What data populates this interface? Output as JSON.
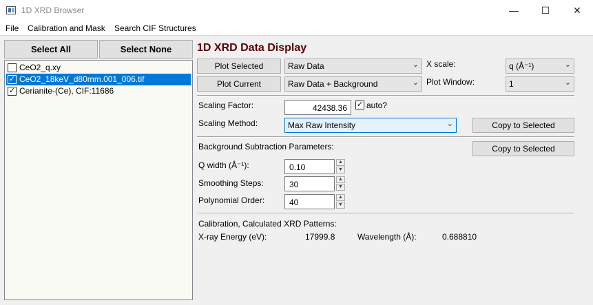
{
  "window": {
    "title": "1D XRD Browser",
    "minimize": "—",
    "maximize": "☐",
    "close": "✕"
  },
  "menu": {
    "items": [
      "File",
      "Calibration and Mask",
      "Search CIF Structures"
    ]
  },
  "left": {
    "select_all": "Select All",
    "select_none": "Select None",
    "files": [
      {
        "label": "CeO2_q.xy",
        "checked": false,
        "selected": false
      },
      {
        "label": "CeO2_18keV_d80mm.001_006.tif",
        "checked": true,
        "selected": true
      },
      {
        "label": "Cerianite-(Ce), CIF:11686",
        "checked": true,
        "selected": false
      }
    ]
  },
  "main": {
    "heading": "1D XRD Data Display",
    "plot_selected": "Plot Selected",
    "plot_current": "Plot Current",
    "data_mode_1": "Raw Data",
    "data_mode_2": "Raw Data + Background",
    "xscale_label": "X scale:",
    "xscale_value": "q (Å⁻¹)",
    "plotwin_label": "Plot Window:",
    "plotwin_value": "1",
    "scaling_factor_label": "Scaling Factor:",
    "scaling_factor_value": "42438.36",
    "auto_label": "auto?",
    "auto_checked": true,
    "scaling_method_label": "Scaling Method:",
    "scaling_method_value": "Max Raw Intensity",
    "copy_selected": "Copy to Selected",
    "bg_section": "Background Subtraction Parameters:",
    "qwidth_label": "Q width (Å⁻¹):",
    "qwidth_value": "0.10",
    "smooth_label": "Smoothing Steps:",
    "smooth_value": "30",
    "poly_label": "Polynomial Order:",
    "poly_value": "40",
    "calib_section": "Calibration, Calculated XRD Patterns:",
    "energy_label": "X-ray Energy (eV):",
    "energy_value": "17999.8",
    "wavelength_label": "Wavelength (Å):",
    "wavelength_value": "0.688810"
  },
  "icons": {
    "dropdown": "chevron-down-icon",
    "check": "checkmark-icon"
  }
}
